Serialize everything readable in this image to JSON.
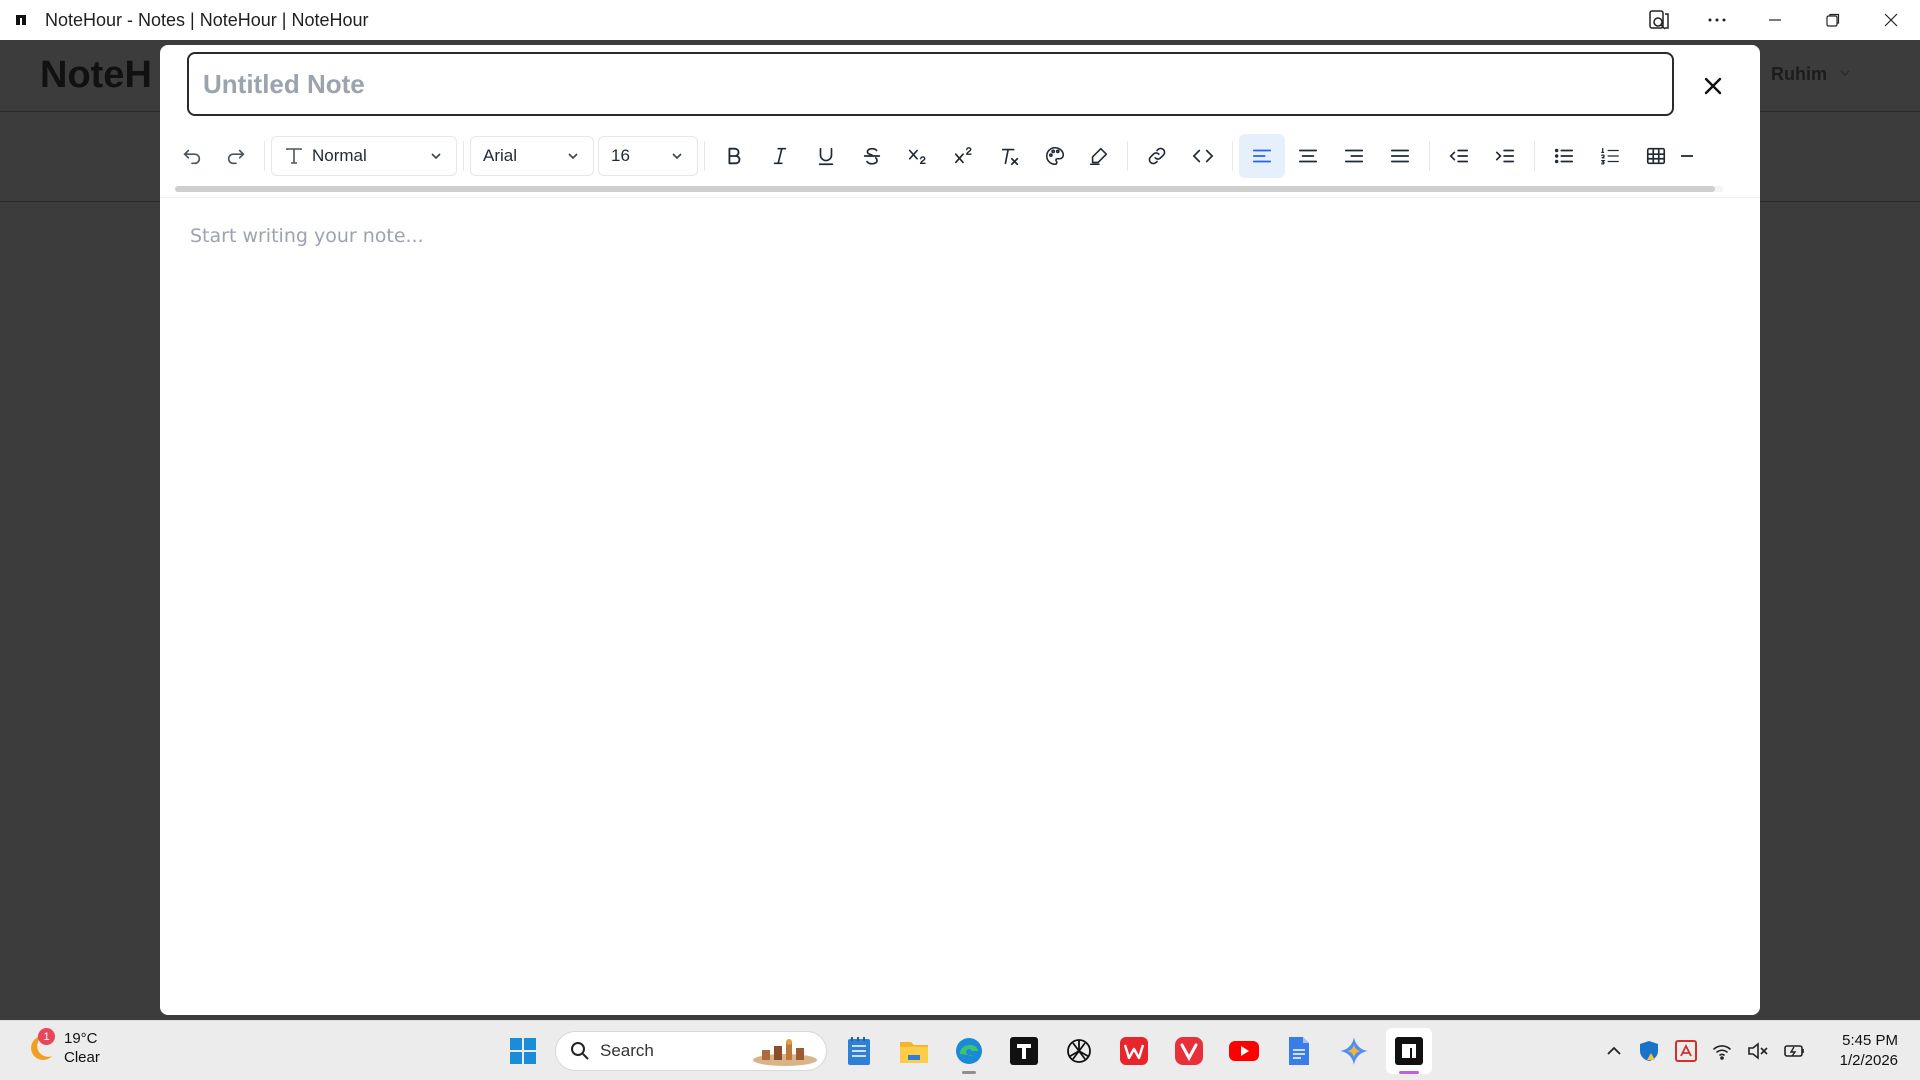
{
  "window": {
    "title": "NoteHour - Notes | NoteHour | NoteHour"
  },
  "background_app": {
    "logo": "NoteH",
    "user_name": "Ruhim"
  },
  "modal": {
    "title_placeholder": "Untitled Note",
    "title_value": "",
    "editor_placeholder": "Start writing your note..."
  },
  "toolbar": {
    "heading_style": "Normal",
    "font_family": "Arial",
    "font_size": "16",
    "active_alignment": "align-left",
    "accent_color": "#2563eb",
    "icons": [
      "undo-icon",
      "redo-icon",
      "bold-icon",
      "italic-icon",
      "underline-icon",
      "strikethrough-icon",
      "subscript-icon",
      "superscript-icon",
      "clear-format-icon",
      "text-color-icon",
      "highlight-icon",
      "link-icon",
      "code-icon",
      "align-left-icon",
      "align-center-icon",
      "align-right-icon",
      "justify-icon",
      "outdent-icon",
      "indent-icon",
      "bullet-list-icon",
      "numbered-list-icon",
      "table-icon",
      "horizontal-rule-icon"
    ]
  },
  "taskbar": {
    "weather": {
      "temp": "19°C",
      "condition": "Clear",
      "badge": "1"
    },
    "search_label": "Search",
    "clock": {
      "time": "5:45 PM",
      "date": "1/2/2026"
    }
  }
}
